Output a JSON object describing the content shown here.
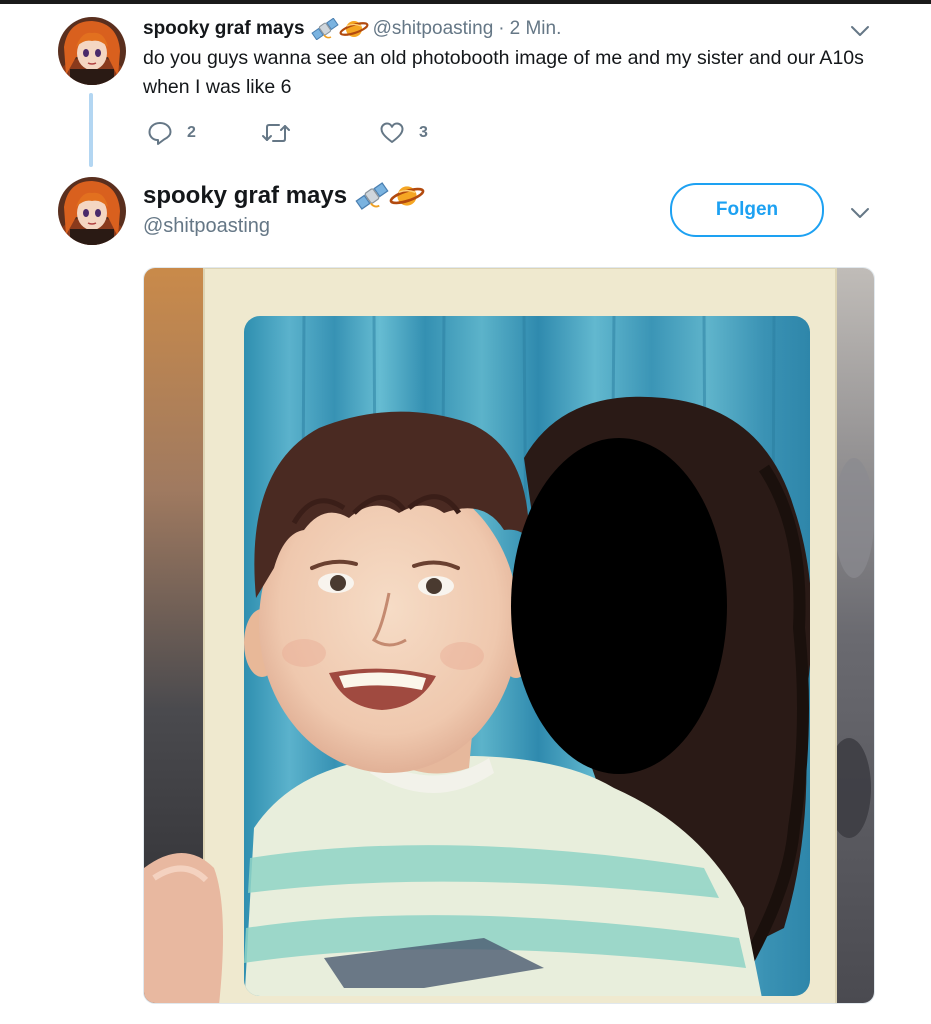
{
  "thread": {
    "tweet1": {
      "author_name": "spooky graf mays",
      "name_emojis": [
        "satellite-icon",
        "ringed-planet-icon"
      ],
      "handle": "@shitpoasting",
      "separator": "·",
      "time": "2 Min.",
      "text": "do you guys wanna see an old photobooth image of me and my sister and our A10s when I was like 6",
      "actions": {
        "reply_count": "2",
        "retweet_count": "",
        "like_count": "3"
      }
    },
    "tweet2": {
      "author_name": "spooky graf mays",
      "name_emojis": [
        "satellite-icon",
        "ringed-planet-icon"
      ],
      "handle": "@shitpoasting",
      "follow_label": "Folgen",
      "media": {
        "kind": "photo",
        "subject": "photobooth-print-photo"
      }
    }
  },
  "colors": {
    "accent": "#1da1f2",
    "thread_line": "#b3d6f2",
    "secondary_text": "#657786",
    "primary_text": "#14171a"
  }
}
